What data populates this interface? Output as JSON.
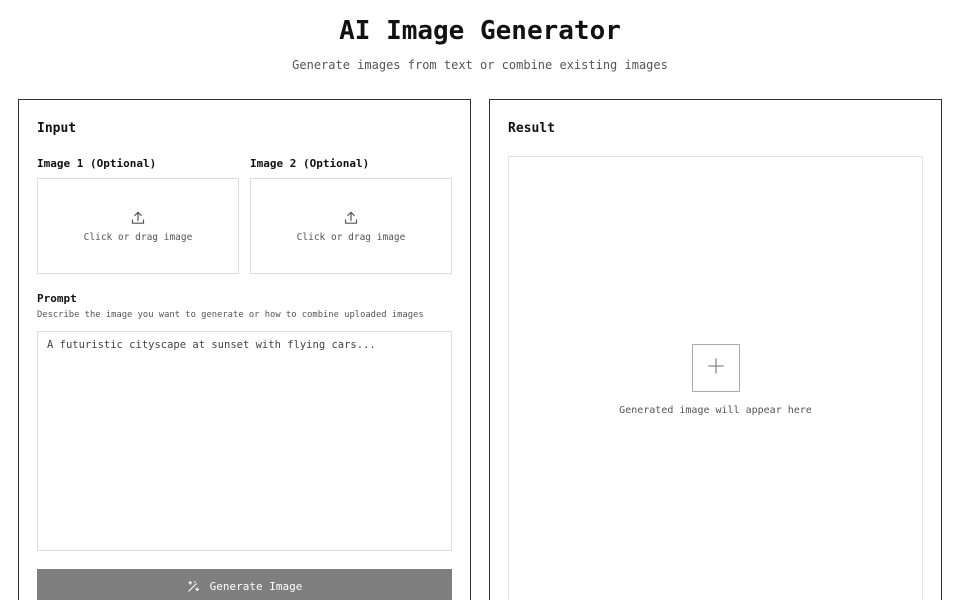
{
  "header": {
    "title": "AI Image Generator",
    "subtitle": "Generate images from text or combine existing images"
  },
  "input_panel": {
    "heading": "Input",
    "uploads": [
      {
        "label": "Image 1 (Optional)",
        "hint": "Click or drag image",
        "icon": "upload-icon"
      },
      {
        "label": "Image 2 (Optional)",
        "hint": "Click or drag image",
        "icon": "upload-icon"
      }
    ],
    "prompt": {
      "label": "Prompt",
      "help": "Describe the image you want to generate or how to combine uploaded images",
      "placeholder": "A futuristic cityscape at sunset with flying cars...",
      "value": ""
    },
    "generate_button": {
      "label": "Generate Image",
      "icon": "magic-wand-icon",
      "background": "#7f7f7f"
    }
  },
  "result_panel": {
    "heading": "Result",
    "placeholder_icon": "plus-icon",
    "hint": "Generated image will appear here"
  }
}
